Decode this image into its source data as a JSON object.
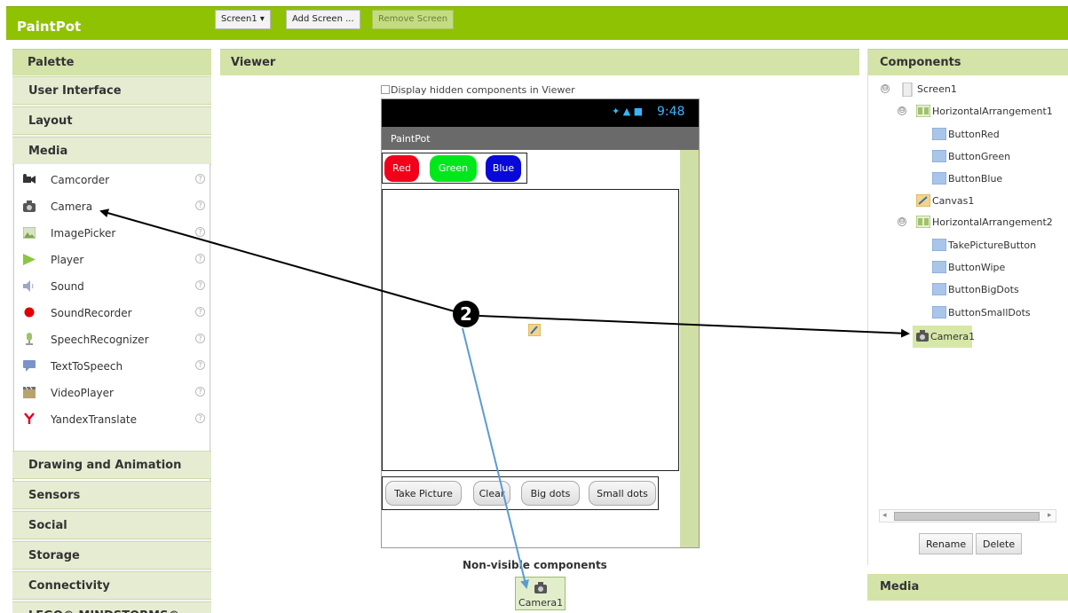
{
  "app": {
    "title": "PaintPot",
    "screen_select": "Screen1 ▾",
    "add_screen": "Add Screen ...",
    "remove_screen": "Remove Screen"
  },
  "palette": {
    "header": "Palette",
    "categories_top": [
      "User Interface",
      "Layout",
      "Media"
    ],
    "media_items": [
      {
        "label": "Camcorder",
        "icon": "camcorder-icon"
      },
      {
        "label": "Camera",
        "icon": "camera-icon"
      },
      {
        "label": "ImagePicker",
        "icon": "image-picker-icon"
      },
      {
        "label": "Player",
        "icon": "player-icon"
      },
      {
        "label": "Sound",
        "icon": "sound-icon"
      },
      {
        "label": "SoundRecorder",
        "icon": "sound-recorder-icon"
      },
      {
        "label": "SpeechRecognizer",
        "icon": "speech-recognizer-icon"
      },
      {
        "label": "TextToSpeech",
        "icon": "text-to-speech-icon"
      },
      {
        "label": "VideoPlayer",
        "icon": "video-player-icon"
      },
      {
        "label": "YandexTranslate",
        "icon": "yandex-translate-icon"
      }
    ],
    "help": "?",
    "categories_bottom": [
      "Drawing and Animation",
      "Sensors",
      "Social",
      "Storage",
      "Connectivity",
      "LEGO® MINDSTORMS®"
    ]
  },
  "viewer": {
    "header": "Viewer",
    "hidden_checkbox_label": "Display hidden components in Viewer",
    "status_time": "9:48",
    "status_icons": "✦ ▲ ■",
    "phone_title": "PaintPot",
    "color_buttons": [
      "Red",
      "Green",
      "Blue"
    ],
    "action_buttons": [
      "Take Picture",
      "Clear",
      "Big dots",
      "Small dots"
    ],
    "nonvisible_label": "Non-visible components",
    "nonvisible_item": "Camera1"
  },
  "components": {
    "header": "Components",
    "tree": [
      {
        "label": "Screen1",
        "toggle": "⊖",
        "icon": "screen-icon"
      },
      {
        "label": "HorizontalArrangement1",
        "toggle": "⊖",
        "icon": "arrangement-icon"
      },
      {
        "label": "ButtonRed",
        "icon": "button-icon"
      },
      {
        "label": "ButtonGreen",
        "icon": "button-icon"
      },
      {
        "label": "ButtonBlue",
        "icon": "button-icon"
      },
      {
        "label": "Canvas1",
        "icon": "canvas-icon"
      },
      {
        "label": "HorizontalArrangement2",
        "toggle": "⊖",
        "icon": "arrangement-icon"
      },
      {
        "label": "TakePictureButton",
        "icon": "button-icon"
      },
      {
        "label": "ButtonWipe",
        "icon": "button-icon"
      },
      {
        "label": "ButtonBigDots",
        "icon": "button-icon"
      },
      {
        "label": "ButtonSmallDots",
        "icon": "button-icon"
      },
      {
        "label": "Camera1",
        "icon": "camera-icon",
        "selected": true
      }
    ],
    "rename": "Rename",
    "delete": "Delete",
    "media_header": "Media"
  },
  "annotation": {
    "badge": "2"
  },
  "colors": {
    "accent_green": "#8fc202",
    "red_button": "#f2001b",
    "green_button": "#00e81c",
    "blue_button": "#0808d8",
    "arrow_black": "#000000",
    "arrow_blue": "#5b9bd5"
  }
}
